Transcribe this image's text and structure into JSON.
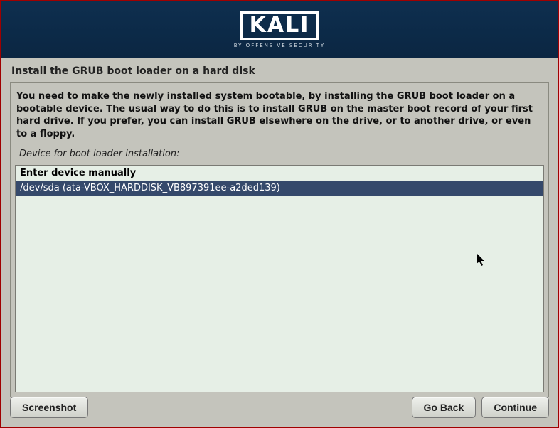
{
  "header": {
    "brand": "KALI",
    "subtitle": "BY OFFENSIVE SECURITY"
  },
  "title": "Install the GRUB boot loader on a hard disk",
  "instructions": "You need to make the newly installed system bootable, by installing the GRUB boot loader on a bootable device. The usual way to do this is to install GRUB on the master boot record of your first hard drive. If you prefer, you can install GRUB elsewhere on the drive, or to another drive, or even to a floppy.",
  "device_prompt": "Device for boot loader installation:",
  "options": [
    {
      "label": "Enter device manually",
      "selected": false
    },
    {
      "label": "/dev/sda  (ata-VBOX_HARDDISK_VB897391ee-a2ded139)",
      "selected": true
    }
  ],
  "buttons": {
    "screenshot": "Screenshot",
    "goback": "Go Back",
    "continue": "Continue"
  }
}
